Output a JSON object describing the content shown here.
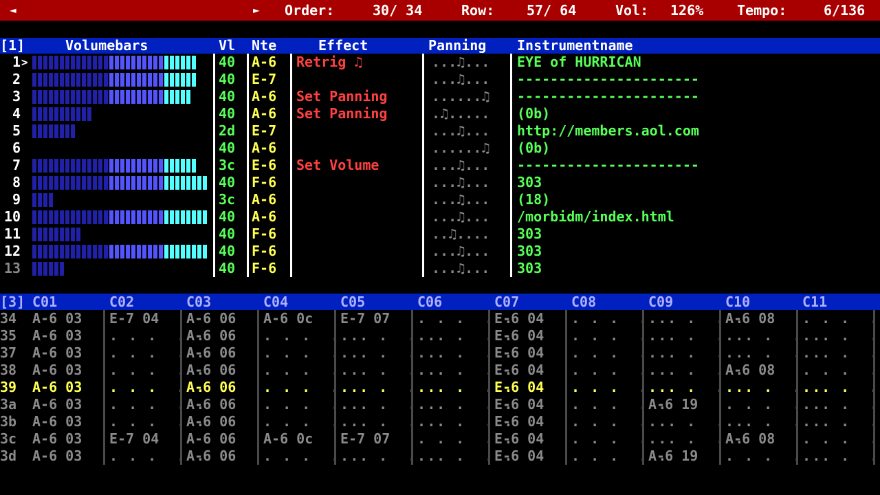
{
  "topbar": {
    "prev_icon": "◄",
    "next_icon": "►",
    "order_label": "Order:",
    "order_value": "30/ 34",
    "row_label": "Row:",
    "row_value": "57/ 64",
    "vol_label": "Vol:",
    "vol_value": "126%",
    "tempo_label": "Tempo:",
    "tempo_value": "6/136"
  },
  "info_header": {
    "page": "[1]",
    "volumebars": "Volumebars",
    "vl": "Vl",
    "nte": "Nte",
    "effect": "Effect",
    "panning": "Panning",
    "instrumentname": "Instrumentname"
  },
  "channels": [
    {
      "num": "1",
      "cursor": ">",
      "bars": [
        14,
        10,
        6
      ],
      "vol": "40",
      "note": "A-6",
      "effect": "Retrig ♫",
      "pan": "...♫...",
      "inst": "EYE of HURRICAN"
    },
    {
      "num": "2",
      "cursor": "",
      "bars": [
        14,
        10,
        6
      ],
      "vol": "40",
      "note": "E-7",
      "effect": "",
      "pan": "...♫...",
      "inst": "----------------------"
    },
    {
      "num": "3",
      "cursor": "",
      "bars": [
        14,
        10,
        5
      ],
      "vol": "40",
      "note": "A-6",
      "effect": "Set Panning",
      "pan": "......♫",
      "inst": "----------------------"
    },
    {
      "num": "4",
      "cursor": "",
      "bars": [
        11,
        0,
        0
      ],
      "vol": "40",
      "note": "A-6",
      "effect": "Set Panning",
      "pan": ".♫.....",
      "inst": "(0b)"
    },
    {
      "num": "5",
      "cursor": "",
      "bars": [
        8,
        0,
        0
      ],
      "vol": "2d",
      "note": "E-7",
      "effect": "",
      "pan": "...♫...",
      "inst": "http://members.aol.com"
    },
    {
      "num": "6",
      "cursor": "",
      "bars": [
        0,
        0,
        0
      ],
      "vol": "40",
      "note": "A-6",
      "effect": "",
      "pan": "......♫",
      "inst": "(0b)"
    },
    {
      "num": "7",
      "cursor": "",
      "bars": [
        14,
        10,
        6
      ],
      "vol": "3c",
      "note": "E-6",
      "effect": "Set Volume",
      "pan": "...♫...",
      "inst": "----------------------"
    },
    {
      "num": "8",
      "cursor": "",
      "bars": [
        14,
        10,
        8
      ],
      "vol": "40",
      "note": "F-6",
      "effect": "",
      "pan": "...♫...",
      "inst": "303"
    },
    {
      "num": "9",
      "cursor": "",
      "bars": [
        4,
        0,
        0
      ],
      "vol": "3c",
      "note": "A-6",
      "effect": "",
      "pan": "...♫...",
      "inst": "(18)"
    },
    {
      "num": "10",
      "cursor": "",
      "bars": [
        14,
        10,
        8
      ],
      "vol": "40",
      "note": "A-6",
      "effect": "",
      "pan": "...♫...",
      "inst": "/morbidm/index.html"
    },
    {
      "num": "11",
      "cursor": "",
      "bars": [
        9,
        0,
        0
      ],
      "vol": "40",
      "note": "F-6",
      "effect": "",
      "pan": "..♫....",
      "inst": "303"
    },
    {
      "num": "12",
      "cursor": "",
      "bars": [
        14,
        10,
        8
      ],
      "vol": "40",
      "note": "F-6",
      "effect": "",
      "pan": "...♫...",
      "inst": "303"
    },
    {
      "num": "13",
      "cursor": "",
      "bars": [
        6,
        0,
        0
      ],
      "vol": "40",
      "note": "F-6",
      "effect": "",
      "pan": "...♫...",
      "inst": "303"
    }
  ],
  "pattern_header": {
    "page": "[3]",
    "columns": [
      "C01",
      "C02",
      "C03",
      "C04",
      "C05",
      "C06",
      "C07",
      "C08",
      "C09",
      "C10",
      "C11"
    ]
  },
  "pattern_rows": [
    {
      "row": "34",
      "cells": [
        "A-6 03",
        "E-7 04",
        "A-6 06",
        "A-6 0c",
        "E-7 07",
        "",
        "E-6 04",
        "",
        "",
        "A-6 08",
        ""
      ]
    },
    {
      "row": "35",
      "cells": [
        "A-6 03",
        "",
        "A-6 06",
        "",
        "",
        "",
        "E-6 04",
        "",
        "",
        "",
        ""
      ]
    },
    {
      "row": "37",
      "cells": [
        "A-6 03",
        "",
        "A-6 06",
        "",
        "",
        "",
        "E-6 04",
        "",
        "",
        "",
        ""
      ]
    },
    {
      "row": "38",
      "cells": [
        "A-6 03",
        "",
        "A-6 06",
        "",
        "",
        "",
        "E-6 04",
        "",
        "",
        "A-6 08",
        ""
      ]
    },
    {
      "row": "39",
      "cells": [
        "A-6 03",
        "",
        "A-6 06",
        "",
        "",
        "",
        "E-6 04",
        "",
        "",
        "",
        ""
      ],
      "highlight": true
    },
    {
      "row": "3a",
      "cells": [
        "A-6 03",
        "",
        "A-6 06",
        "",
        "",
        "",
        "E-6 04",
        "",
        "A-6 19",
        "",
        ""
      ]
    },
    {
      "row": "3b",
      "cells": [
        "A-6 03",
        "",
        "A-6 06",
        "",
        "",
        "",
        "E-6 04",
        "",
        "",
        "",
        ""
      ]
    },
    {
      "row": "3c",
      "cells": [
        "A-6 03",
        "E-7 04",
        "A-6 06",
        "A-6 0c",
        "E-7 07",
        "",
        "E-6 04",
        "",
        "",
        "A-6 08",
        ""
      ]
    },
    {
      "row": "3d",
      "cells": [
        "A-6 03",
        "",
        "A-6 06",
        "",
        "",
        "",
        "E-6 04",
        "",
        "A-6 19",
        "",
        ""
      ]
    }
  ],
  "empty_cell": ". . .  . .",
  "colors": {
    "status_bar": "#a80000",
    "header_bar": "#0020c0",
    "volume": "#58ff58",
    "note": "#ffff54",
    "effect": "#ff4040",
    "instrument": "#58ff58",
    "bar_dark": "#2020a8",
    "bar_mid": "#5454ff",
    "bar_light": "#54ffff"
  }
}
